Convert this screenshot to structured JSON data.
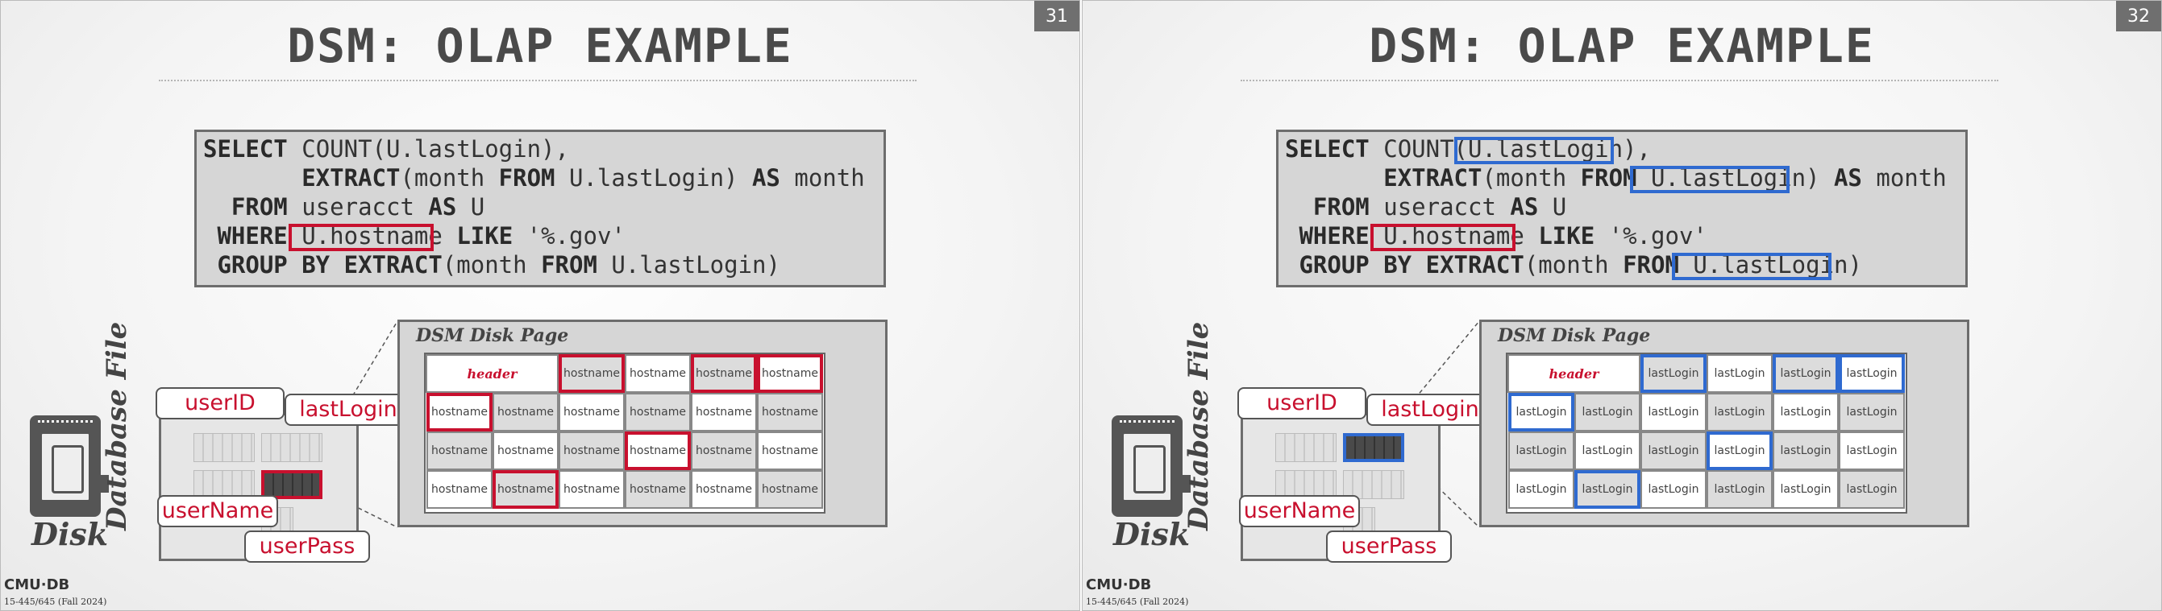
{
  "slides": [
    {
      "page_number": "31",
      "title": "DSM: OLAP EXAMPLE",
      "sql": {
        "line1_kw": "SELECT",
        "line1_fn": "COUNT(U.lastLogin),",
        "line2_kw": "EXTRACT",
        "line2_a": "(month",
        "line2_from": "FROM",
        "line2_b": "U.lastLogin)",
        "line2_as": "AS",
        "line2_c": "month",
        "line3_kw": "FROM",
        "line3_a": "useracct",
        "line3_as": "AS",
        "line3_b": "U",
        "line4_kw": "WHERE",
        "line4_a": "U.hostname",
        "line4_like": "LIKE",
        "line4_b": "'%.gov'",
        "line5_kw": "GROUP BY",
        "line5_fn": "EXTRACT",
        "line5_a": "(month",
        "line5_from": "FROM",
        "line5_b": "U.lastLogin)"
      },
      "labels": {
        "disk": "Disk",
        "database_file": "Database File",
        "page": "DSM Disk Page",
        "header": "header"
      },
      "callouts": {
        "user_id": "userID",
        "last_login": "lastLogin",
        "user_name": "userName",
        "user_pass": "userPass"
      },
      "cell_text": "hostname"
    },
    {
      "page_number": "32",
      "title": "DSM: OLAP EXAMPLE",
      "labels": {
        "disk": "Disk",
        "database_file": "Database File",
        "page": "DSM Disk Page",
        "header": "header"
      },
      "callouts": {
        "user_id": "userID",
        "last_login": "lastLogin",
        "user_name": "userName",
        "user_pass": "userPass"
      },
      "cell_text": "lastLogin"
    }
  ],
  "footer": {
    "logo": "CMU·DB",
    "course": "15-445/645 (Fall 2024)"
  },
  "colors": {
    "red": "#c8102e",
    "blue": "#2f6ad0"
  }
}
